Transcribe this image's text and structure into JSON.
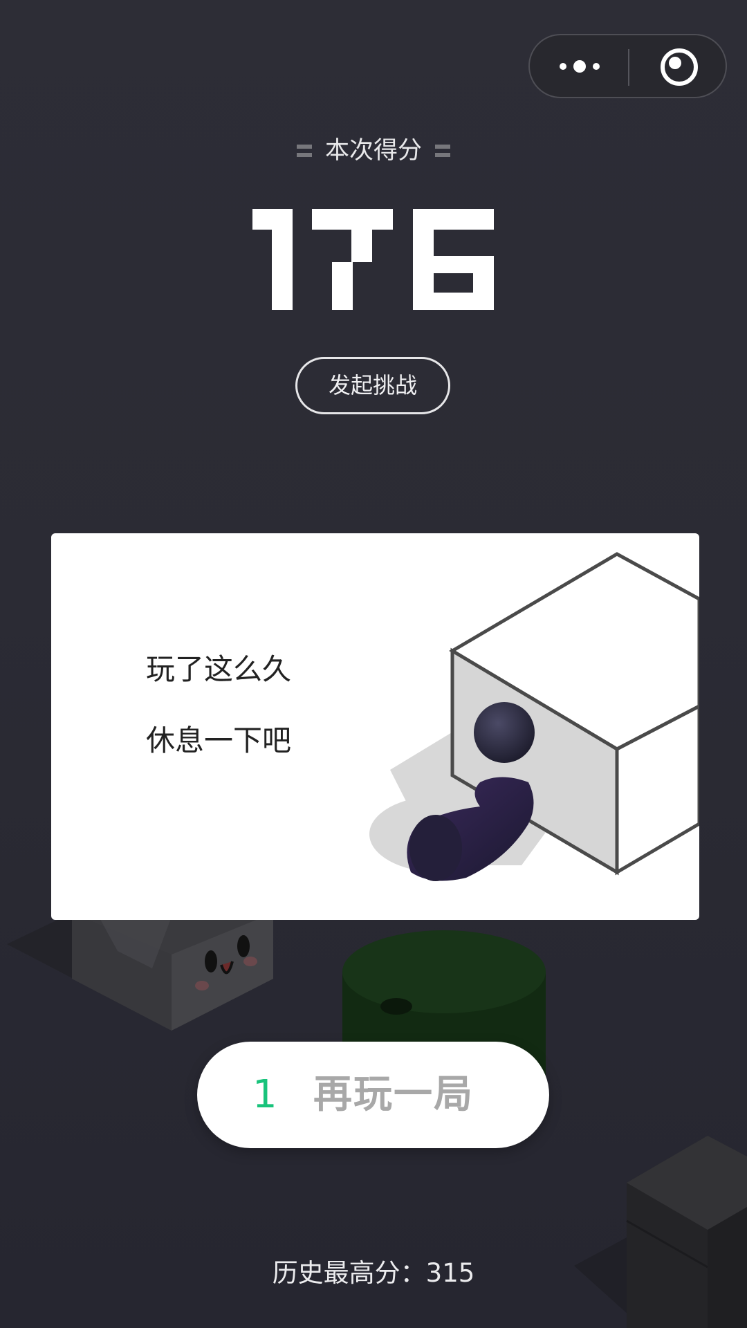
{
  "header": {
    "capsule": {
      "more_icon": "more-dots-icon",
      "close_icon": "target-circle-icon"
    }
  },
  "result": {
    "score_label": "本次得分",
    "score": "176",
    "challenge_label": "发起挑战"
  },
  "rest_card": {
    "line1": "玩了这么久",
    "line2": "休息一下吧"
  },
  "replay": {
    "number": "1",
    "label": "再玩一局"
  },
  "best": {
    "text": "历史最高分：315"
  },
  "colors": {
    "background": "#2b2b33",
    "accent_green": "#18c37b",
    "card": "#ffffff"
  }
}
